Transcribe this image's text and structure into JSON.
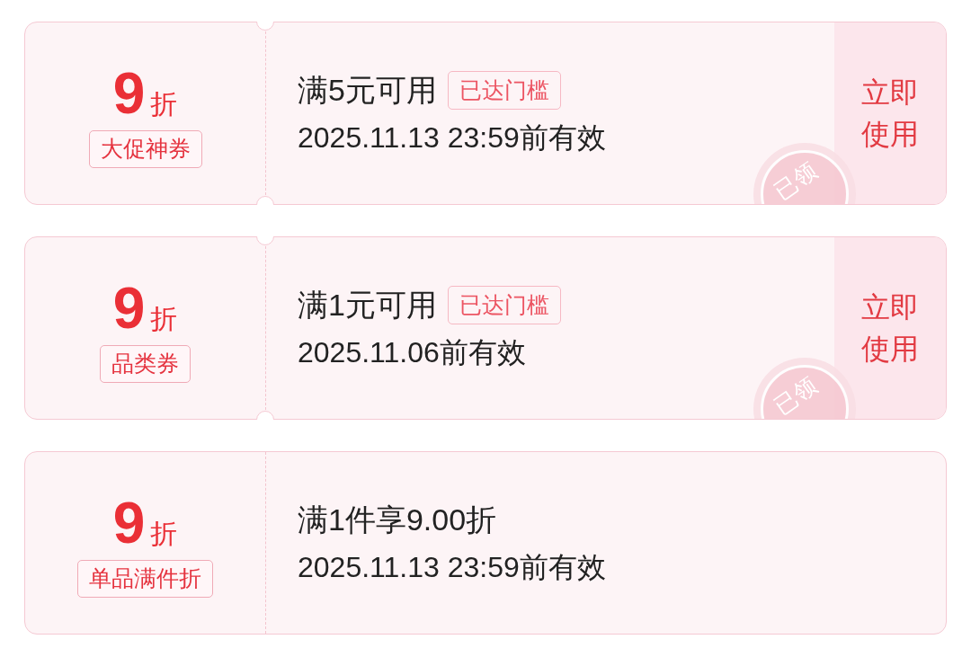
{
  "coupons": [
    {
      "kind": "ticket",
      "discount": "9",
      "unit": "折",
      "type_tag": "大促神券",
      "condition": "满5元可用",
      "threshold_tag": "已达门槛",
      "validity": "2025.11.13 23:59前有效",
      "action": "立即使用",
      "stamp": "已领"
    },
    {
      "kind": "ticket",
      "discount": "9",
      "unit": "折",
      "type_tag": "品类券",
      "condition": "满1元可用",
      "threshold_tag": "已达门槛",
      "validity": "2025.11.06前有效",
      "action": "立即使用",
      "stamp": "已领"
    },
    {
      "kind": "plain",
      "discount": "9",
      "unit": "折",
      "type_tag": "单品满件折",
      "condition": "满1件享9.00折",
      "validity": "2025.11.13 23:59前有效"
    }
  ]
}
